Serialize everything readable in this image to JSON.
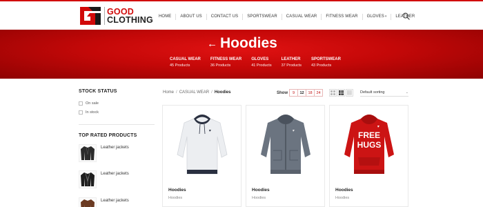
{
  "brand": {
    "line1": "GOOD",
    "line2": "CLOTHING",
    "accent": "#d10a0a"
  },
  "nav": {
    "items": [
      "HOME",
      "ABOUT US",
      "CONTACT US",
      "SPORTSWEAR",
      "CASUAL WEAR",
      "FITNESS WEAR",
      "GLOVES",
      "LEATHER"
    ],
    "has_dropdown": "GLOVES",
    "search_icon": "search-icon"
  },
  "banner": {
    "title": "Hoodies",
    "back_arrow": "←",
    "categories": [
      {
        "name": "CASUAL WEAR",
        "count": "45 Products"
      },
      {
        "name": "FITNESS WEAR",
        "count": "36 Products"
      },
      {
        "name": "GLOVES",
        "count": "41 Products"
      },
      {
        "name": "LEATHER",
        "count": "37 Products"
      },
      {
        "name": "SPORTSWEAR",
        "count": "43 Products"
      }
    ]
  },
  "sidebar": {
    "stock_heading": "STOCK STATUS",
    "stock_options": [
      "On sale",
      "In stock"
    ],
    "top_heading": "TOP RATED PRODUCTS",
    "top_products": [
      "Leather jackets",
      "Leather jackets",
      "Leather jackets"
    ]
  },
  "toolbar": {
    "breadcrumb": [
      "Home",
      "CASUAL WEAR",
      "Hoodies"
    ],
    "show_label": "Show",
    "show_options": [
      "9",
      "12",
      "18",
      "24"
    ],
    "show_selected": "12",
    "sort_value": "Default sorting"
  },
  "products": [
    {
      "title": "Hoodies",
      "category": "Hoodies",
      "color": "#e9eaec"
    },
    {
      "title": "Hoodies",
      "category": "Hoodies",
      "color": "#6b7480"
    },
    {
      "title": "Hoodies",
      "category": "Hoodies",
      "color": "#cc1414",
      "print": "FREE HUGS"
    }
  ]
}
